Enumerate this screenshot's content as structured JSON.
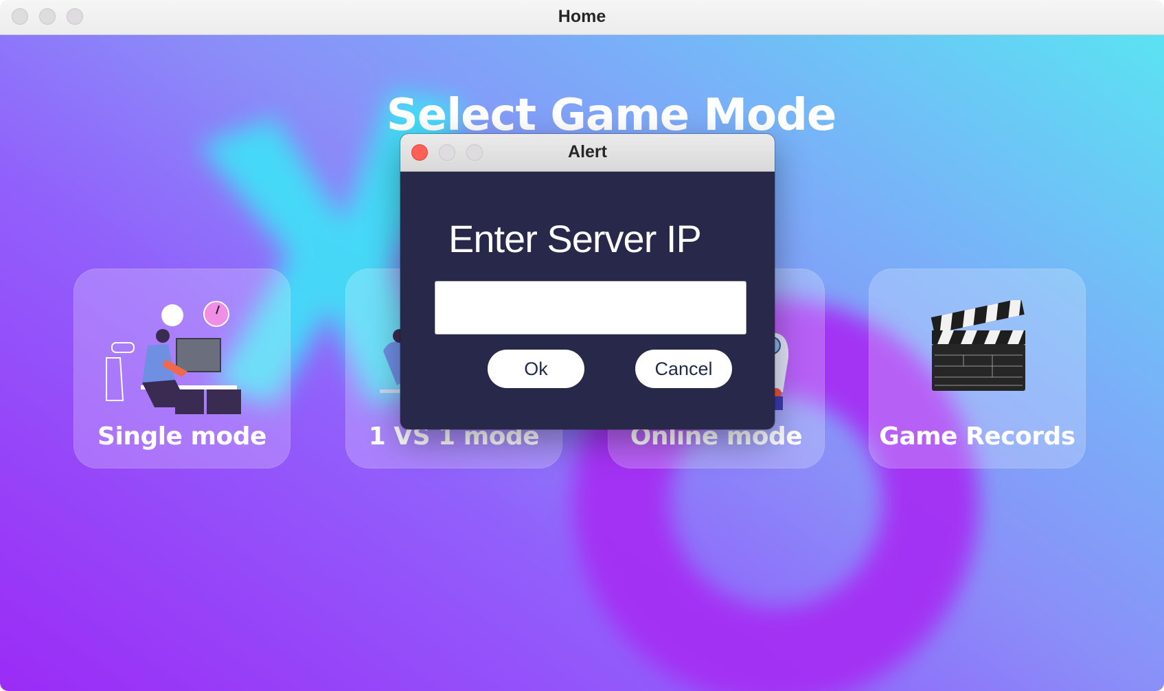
{
  "window": {
    "title": "Home"
  },
  "screen": {
    "heading": "Select Game Mode"
  },
  "modes": [
    {
      "label": "Single mode",
      "icon": "person-at-computer-illustration"
    },
    {
      "label": "1 VS 1 mode",
      "icon": "two-players-illustration"
    },
    {
      "label": "Online mode",
      "icon": "online-player-illustration"
    },
    {
      "label": "Game Records",
      "icon": "clapperboard-icon"
    }
  ],
  "dialog": {
    "title": "Alert",
    "prompt": "Enter Server IP",
    "input_value": "",
    "ok_label": "Ok",
    "cancel_label": "Cancel"
  },
  "colors": {
    "background_gradient": [
      "#9b2bf6",
      "#8a8ff8",
      "#5ae3f2"
    ],
    "dialog_background": "#28294a",
    "close_button": "#fe5f57"
  }
}
